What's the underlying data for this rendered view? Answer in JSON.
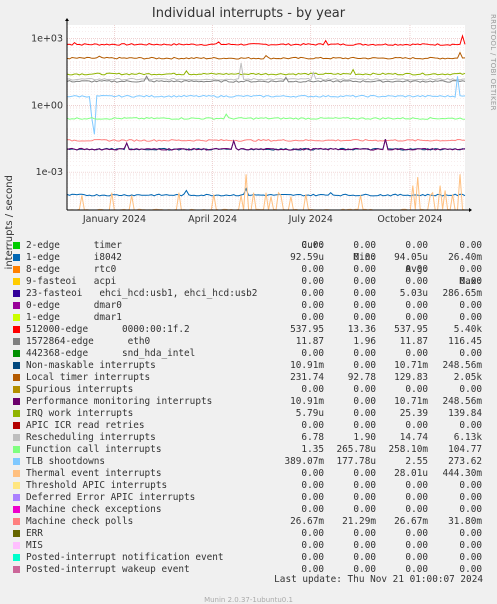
{
  "title": "Individual interrupts - by year",
  "side_credit": "RRDTOOL / TOBI OETIKER",
  "ylabel": "interrupts / second",
  "legend_header": {
    "cur": "Cur:",
    "min": "Min:",
    "avg": "Avg:",
    "max": "Max:"
  },
  "legend": [
    {
      "name": "2-edge      timer",
      "color": "#00cc00",
      "cur": "0.00",
      "min": "0.00",
      "avg": "0.00",
      "max": "0.00"
    },
    {
      "name": "1-edge      i8042",
      "color": "#0066b3",
      "cur": "92.59u",
      "min": "0.00",
      "avg": "94.05u",
      "max": "26.40m"
    },
    {
      "name": "8-edge      rtc0",
      "color": "#ff8000",
      "cur": "0.00",
      "min": "0.00",
      "avg": "0.00",
      "max": "0.00"
    },
    {
      "name": "9-fasteoi   acpi",
      "color": "#ffcc00",
      "cur": "0.00",
      "min": "0.00",
      "avg": "0.00",
      "max": "0.00"
    },
    {
      "name": "23-fasteoi   ehci_hcd:usb1, ehci_hcd:usb2",
      "color": "#330099",
      "cur": "0.00",
      "min": "0.00",
      "avg": "5.03u",
      "max": "286.65m"
    },
    {
      "name": "0-edge      dmar0",
      "color": "#990099",
      "cur": "0.00",
      "min": "0.00",
      "avg": "0.00",
      "max": "0.00"
    },
    {
      "name": "1-edge      dmar1",
      "color": "#ccff00",
      "cur": "0.00",
      "min": "0.00",
      "avg": "0.00",
      "max": "0.00"
    },
    {
      "name": "512000-edge      0000:00:1f.2",
      "color": "#ff0000",
      "cur": "537.95",
      "min": "13.36",
      "avg": "537.95",
      "max": "5.40k"
    },
    {
      "name": "1572864-edge      eth0",
      "color": "#808080",
      "cur": "11.87",
      "min": "1.96",
      "avg": "11.87",
      "max": "116.45"
    },
    {
      "name": "442368-edge      snd_hda_intel",
      "color": "#008f00",
      "cur": "0.00",
      "min": "0.00",
      "avg": "0.00",
      "max": "0.00"
    },
    {
      "name": "Non-maskable interrupts",
      "color": "#00487d",
      "cur": "10.91m",
      "min": "0.00",
      "avg": "10.71m",
      "max": "248.56m"
    },
    {
      "name": "Local timer interrupts",
      "color": "#b35a00",
      "cur": "231.74",
      "min": "92.78",
      "avg": "129.83",
      "max": "2.05k"
    },
    {
      "name": "Spurious interrupts",
      "color": "#b38f00",
      "cur": "0.00",
      "min": "0.00",
      "avg": "0.00",
      "max": "0.00"
    },
    {
      "name": "Performance monitoring interrupts",
      "color": "#6b006b",
      "cur": "10.91m",
      "min": "0.00",
      "avg": "10.71m",
      "max": "248.56m"
    },
    {
      "name": "IRQ work interrupts",
      "color": "#8fb300",
      "cur": "5.79u",
      "min": "0.00",
      "avg": "25.39",
      "max": "139.84"
    },
    {
      "name": "APIC ICR read retries",
      "color": "#b30000",
      "cur": "0.00",
      "min": "0.00",
      "avg": "0.00",
      "max": "0.00"
    },
    {
      "name": "Rescheduling interrupts",
      "color": "#bebebe",
      "cur": "6.78",
      "min": "1.90",
      "avg": "14.74",
      "max": "6.13k"
    },
    {
      "name": "Function call interrupts",
      "color": "#80ff80",
      "cur": "1.35",
      "min": "265.78u",
      "avg": "258.10m",
      "max": "104.77"
    },
    {
      "name": "TLB shootdowns",
      "color": "#80c9ff",
      "cur": "389.07m",
      "min": "177.78u",
      "avg": "2.55",
      "max": "273.62"
    },
    {
      "name": "Thermal event interrupts",
      "color": "#ffc080",
      "cur": "0.00",
      "min": "0.00",
      "avg": "28.01u",
      "max": "444.30m"
    },
    {
      "name": "Threshold APIC interrupts",
      "color": "#ffe680",
      "cur": "0.00",
      "min": "0.00",
      "avg": "0.00",
      "max": "0.00"
    },
    {
      "name": "Deferred Error APIC interrupts",
      "color": "#aa80ff",
      "cur": "0.00",
      "min": "0.00",
      "avg": "0.00",
      "max": "0.00"
    },
    {
      "name": "Machine check exceptions",
      "color": "#ee00cc",
      "cur": "0.00",
      "min": "0.00",
      "avg": "0.00",
      "max": "0.00"
    },
    {
      "name": "Machine check polls",
      "color": "#ff8080",
      "cur": "26.67m",
      "min": "21.29m",
      "avg": "26.67m",
      "max": "31.80m"
    },
    {
      "name": "ERR",
      "color": "#666600",
      "cur": "0.00",
      "min": "0.00",
      "avg": "0.00",
      "max": "0.00"
    },
    {
      "name": "MIS",
      "color": "#ffbfff",
      "cur": "0.00",
      "min": "0.00",
      "avg": "0.00",
      "max": "0.00"
    },
    {
      "name": "Posted-interrupt notification event",
      "color": "#00ffcc",
      "cur": "0.00",
      "min": "0.00",
      "avg": "0.00",
      "max": "0.00"
    },
    {
      "name": "Posted-interrupt wakeup event",
      "color": "#cc6699",
      "cur": "0.00",
      "min": "0.00",
      "avg": "0.00",
      "max": "0.00"
    }
  ],
  "last_update": "Last update: Thu Nov 21 01:00:07 2024",
  "footer": "Munin 2.0.37-1ubuntu0.1",
  "chart_data": {
    "type": "line",
    "title": "Individual interrupts - by year",
    "ylabel": "interrupts / second",
    "yscale": "log",
    "ylim": [
      2e-05,
      4000
    ],
    "y_ticks": [
      {
        "value": 1000,
        "label": "1e+03"
      },
      {
        "value": 1,
        "label": "1e+00"
      },
      {
        "value": 0.001,
        "label": "1e-03"
      }
    ],
    "xlim": [
      "2023-11-18",
      "2024-11-21"
    ],
    "x_ticks": [
      {
        "date": "2024-01-01",
        "label": "January 2024"
      },
      {
        "date": "2024-04-01",
        "label": "April 2024"
      },
      {
        "date": "2024-07-01",
        "label": "July 2024"
      },
      {
        "date": "2024-10-01",
        "label": "October 2024"
      }
    ],
    "grid": true,
    "series": [
      {
        "name": "512000-edge      0000:00:1f.2",
        "color": "#ff0000",
        "level": 537.95,
        "spikes": [
          [
            0.02,
            650
          ],
          [
            0.38,
            700
          ],
          [
            0.65,
            800
          ],
          [
            0.995,
            1300
          ]
        ]
      },
      {
        "name": "Local timer interrupts",
        "color": "#b35a00",
        "level": 129.83,
        "spikes": [
          [
            0.08,
            160
          ],
          [
            0.5,
            170
          ],
          [
            0.99,
            231.74
          ]
        ]
      },
      {
        "name": "IRQ work interrupts",
        "color": "#8fb300",
        "level": 25.39,
        "spikes": [
          [
            0.3,
            35
          ],
          [
            0.72,
            40
          ]
        ]
      },
      {
        "name": "Rescheduling interrupts",
        "color": "#bebebe",
        "level": 14.74,
        "spikes": [
          [
            0.44,
            80
          ],
          [
            0.62,
            30
          ]
        ]
      },
      {
        "name": "1572864-edge      eth0",
        "color": "#808080",
        "level": 11.87,
        "spikes": [
          [
            0.2,
            20
          ],
          [
            0.55,
            18
          ]
        ]
      },
      {
        "name": "TLB shootdowns",
        "color": "#80c9ff",
        "level": 2.55,
        "spikes": [
          [
            0.06,
            0.25
          ],
          [
            0.07,
            0.05
          ],
          [
            0.98,
            20
          ]
        ]
      },
      {
        "name": "Function call interrupts",
        "color": "#80ff80",
        "level": 0.258,
        "spikes": [
          [
            0.4,
            0.4
          ]
        ]
      },
      {
        "name": "Machine check polls",
        "color": "#ff8080",
        "level": 0.0267,
        "spikes": []
      },
      {
        "name": "Non-maskable interrupts",
        "color": "#00487d",
        "level": 0.0107,
        "spikes": [
          [
            0.15,
            0.02
          ],
          [
            0.42,
            0.025
          ],
          [
            0.8,
            0.03
          ]
        ]
      },
      {
        "name": "Performance monitoring interrupts",
        "color": "#6b006b",
        "level": 0.0107,
        "spikes": [
          [
            0.15,
            0.02
          ],
          [
            0.42,
            0.025
          ],
          [
            0.8,
            0.03
          ]
        ]
      },
      {
        "name": "1-edge      i8042",
        "color": "#0066b3",
        "level": 9.4e-05,
        "spikes": [
          [
            0.3,
            0.00015
          ],
          [
            0.45,
            0.00018
          ],
          [
            0.66,
            0.00012
          ]
        ]
      },
      {
        "name": "Thermal event interrupts",
        "color": "#ffc080",
        "level": 2e-05,
        "spikes": [
          [
            0.04,
            9e-05
          ],
          [
            0.11,
            0.00012
          ],
          [
            0.16,
            9e-05
          ],
          [
            0.28,
            0.00012
          ],
          [
            0.37,
            0.0001
          ],
          [
            0.44,
            9e-05
          ],
          [
            0.45,
            0.0008
          ],
          [
            0.47,
            0.00012
          ],
          [
            0.5,
            0.00012
          ],
          [
            0.51,
            8e-05
          ],
          [
            0.53,
            0.00012
          ],
          [
            0.54,
            9e-05
          ],
          [
            0.56,
            8e-05
          ],
          [
            0.6,
            0.0001
          ],
          [
            0.74,
            9e-05
          ],
          [
            0.87,
            0.00025
          ],
          [
            0.88,
            0.0006
          ],
          [
            0.91,
            9e-05
          ],
          [
            0.92,
            0.00012
          ],
          [
            0.94,
            0.00025
          ],
          [
            0.95,
            0.00015
          ],
          [
            0.97,
            0.0001
          ],
          [
            0.99,
            0.0008
          ]
        ]
      }
    ]
  }
}
